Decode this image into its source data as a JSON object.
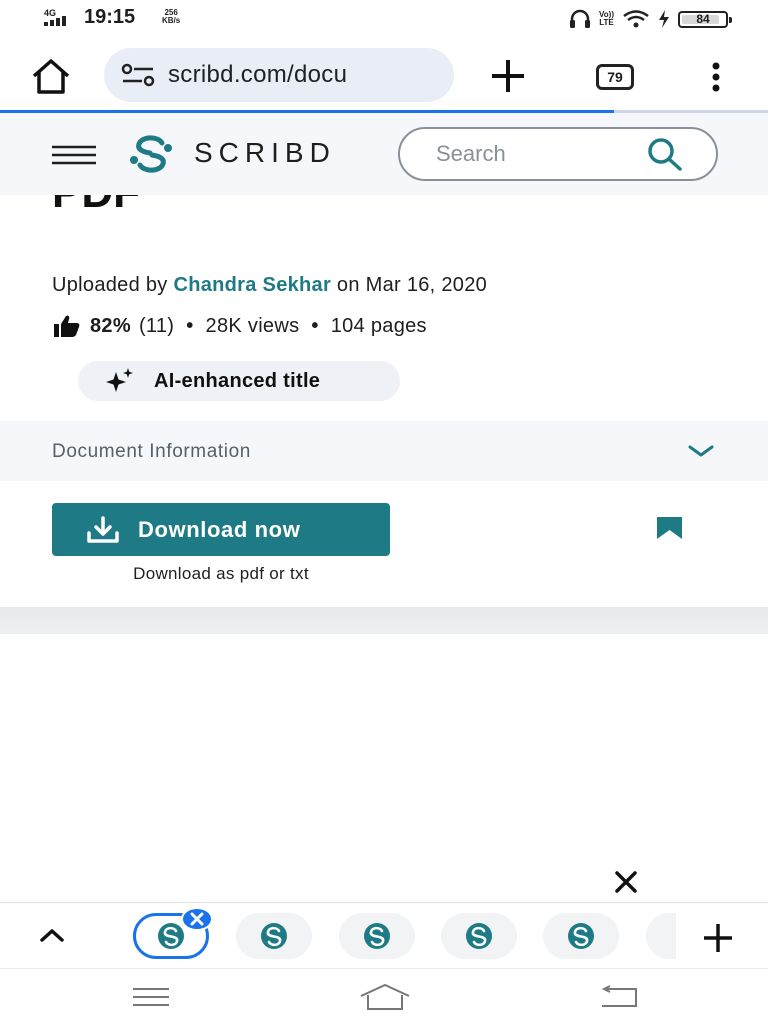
{
  "status_bar": {
    "network": "4G",
    "time": "19:15",
    "speed_value": "256",
    "speed_unit": "KB/s",
    "volte_top": "Vo))",
    "volte_bottom": "LTE",
    "battery": "84"
  },
  "browser": {
    "url": "scribd.com/docu",
    "tab_count": "79",
    "progress": 0.8
  },
  "header": {
    "brand": "SCRIBD",
    "search_placeholder": "Search"
  },
  "document": {
    "title_fragment": "PDF",
    "uploaded_prefix": "Uploaded by",
    "author": "Chandra Sekhar",
    "uploaded_date": "on Mar 16, 2020",
    "rating_pct": "82%",
    "rating_count": "(11)",
    "views": "28K views",
    "pages": "104 pages",
    "ai_badge": "AI-enhanced title",
    "info_label": "Document Information",
    "download_label": "Download now",
    "download_sub": "Download as pdf or txt"
  },
  "colors": {
    "brand_teal": "#1e7b85",
    "chrome_blue": "#1a73e8"
  },
  "icons": [
    "home-icon",
    "site-settings-icon",
    "plus-icon",
    "more-vert-icon",
    "hamburger-icon",
    "scribd-logo",
    "search-icon",
    "thumbs-up-icon",
    "sparkle-icon",
    "chevron-down-icon",
    "download-icon",
    "bookmark-icon",
    "close-icon",
    "chevron-up-icon"
  ]
}
